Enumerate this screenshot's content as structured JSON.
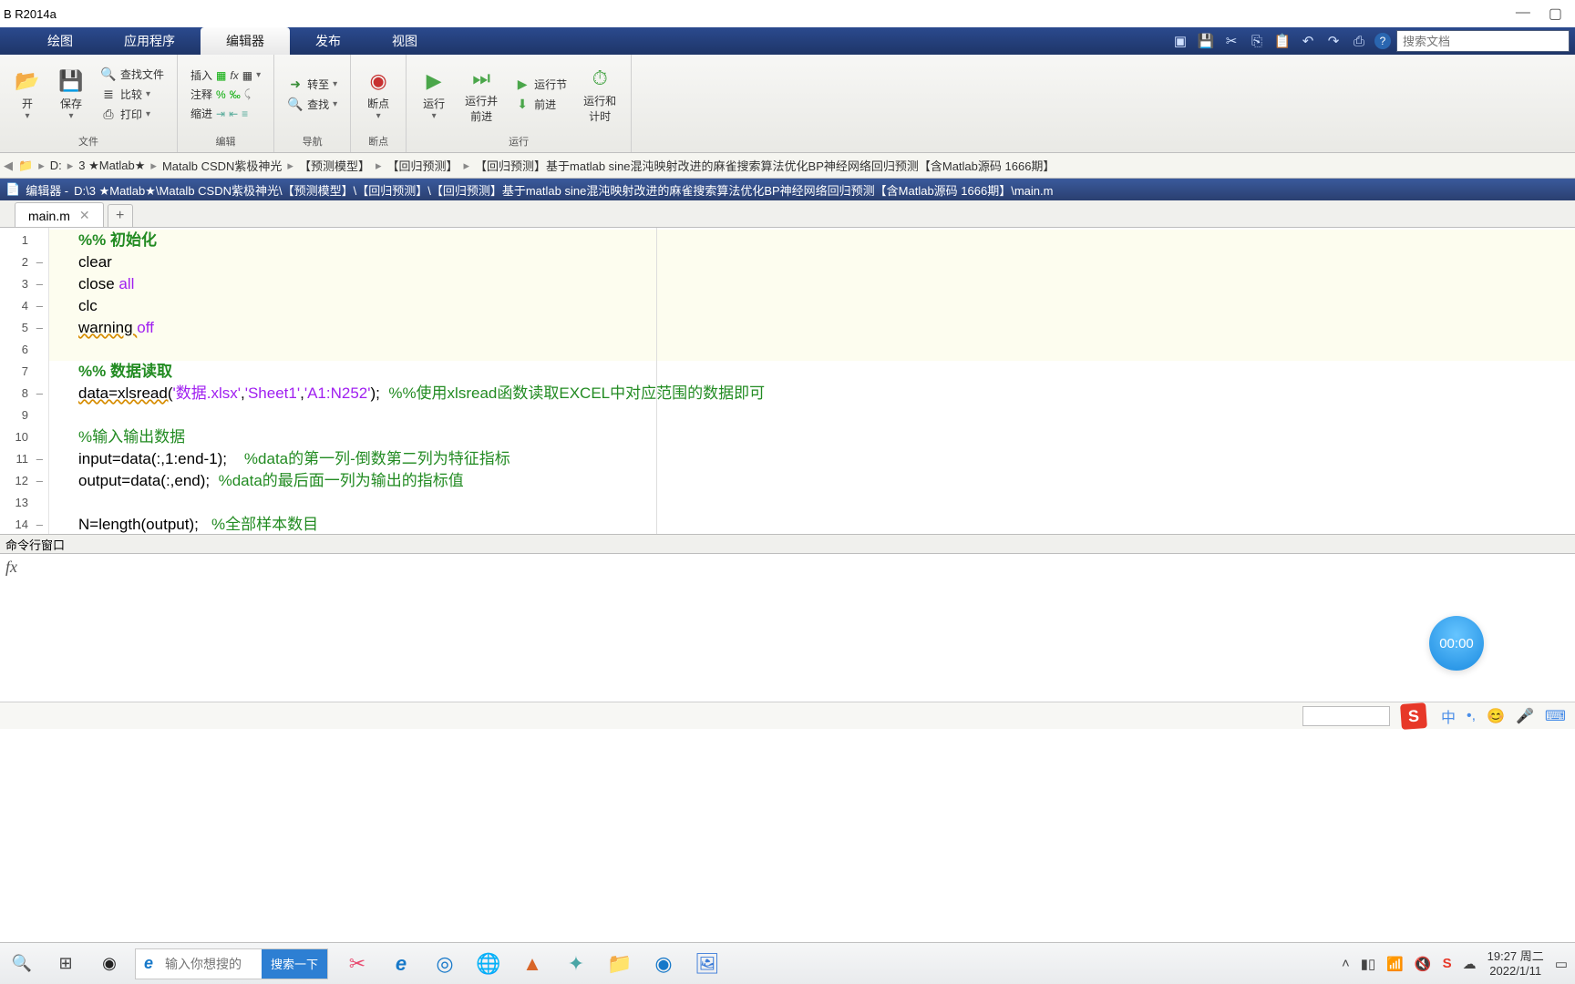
{
  "app": {
    "title": "B R2014a"
  },
  "tabs": {
    "plot": "绘图",
    "apps": "应用程序",
    "editor": "编辑器",
    "publish": "发布",
    "view": "视图"
  },
  "search": {
    "placeholder": "搜索文档"
  },
  "toolstrip": {
    "file": {
      "open": "开",
      "save": "保存",
      "find_files": "查找文件",
      "compare": "比较",
      "print": "打印",
      "group": "文件"
    },
    "edit": {
      "insert": "插入",
      "comment": "注释",
      "indent": "缩进",
      "fx": "fx",
      "group": "编辑"
    },
    "navigate": {
      "goto": "转至",
      "find": "查找",
      "group": "导航"
    },
    "breakpoints": {
      "breakpoints": "断点",
      "group": "断点"
    },
    "run": {
      "run": "运行",
      "run_advance": "运行并\n前进",
      "run_section": "运行节",
      "advance": "前进",
      "run_time": "运行和\n计时",
      "group": "运行"
    }
  },
  "breadcrumb": {
    "drive": "D:",
    "segs": [
      "3 ★Matlab★",
      "Matalb CSDN紫极神光",
      "【预测模型】",
      "【回归预测】",
      "【回归预测】基于matlab sine混沌映射改进的麻雀搜索算法优化BP神经网络回归预测【含Matlab源码 1666期】"
    ]
  },
  "editor": {
    "title_prefix": "编辑器 - ",
    "path": "D:\\3 ★Matlab★\\Matalb CSDN紫极神光\\【预测模型】\\【回归预测】\\【回归预测】基于matlab sine混沌映射改进的麻雀搜索算法优化BP神经网络回归预测【含Matlab源码 1666期】\\main.m",
    "tab": "main.m"
  },
  "code": {
    "l1a": "%% ",
    "l1b": "初始化",
    "l2": "clear",
    "l3a": "close ",
    "l3b": "all",
    "l4": "clc",
    "l5a": "warning ",
    "l5b": "off",
    "l7a": "%% ",
    "l7b": "数据读取",
    "l8a": "data=xlsread(",
    "l8b": "'数据.xlsx'",
    "l8c": ",",
    "l8d": "'Sheet1'",
    "l8e": ",",
    "l8f": "'A1:N252'",
    "l8g": ");  ",
    "l8h": "%%使用xlsread函数读取EXCEL中对应范围的数据即可",
    "l10": "%输入输出数据",
    "l11a": "input=data(:,1:end-1);    ",
    "l11b": "%data的第一列-倒数第二列为特征指标",
    "l12a": "output=data(:,end);  ",
    "l12b": "%data的最后面一列为输出的指标值",
    "l14a": "N=length(output);   ",
    "l14b": "%全部样本数目"
  },
  "cmdwin": {
    "title": "命令行窗口"
  },
  "timer": {
    "value": "00:00"
  },
  "taskbar": {
    "search_placeholder": "输入你想搜的",
    "search_btn": "搜索一下",
    "ime_letter": "S",
    "ime_lang": "中",
    "time": "19:27",
    "dow": "周二",
    "date": "2022/1/11"
  }
}
